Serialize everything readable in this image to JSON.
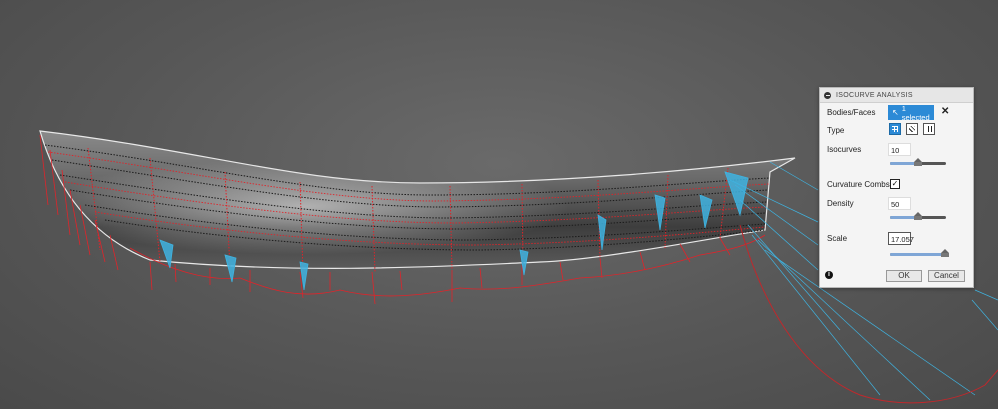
{
  "panel": {
    "title": "ISOCURVE ANALYSIS",
    "collapse_icon": "minus-circle-icon",
    "bodies_label": "Bodies/Faces",
    "selection_label": "1 selected",
    "selection_icon": "cursor-arrow-icon",
    "clear_icon": "close-icon",
    "type_label": "Type",
    "type_options": [
      "grid-both-icon",
      "diagonal-lines-icon",
      "vertical-lines-icon"
    ],
    "isocurves_label": "Isocurves",
    "isocurves_value": "10",
    "isocurves_slider_fraction": 0.5,
    "combs_label": "Curvature Combs",
    "combs_checked": true,
    "density_label": "Density",
    "density_value": "50",
    "density_slider_fraction": 0.5,
    "scale_label": "Scale",
    "scale_value": "17.057",
    "scale_slider_fraction": 0.98,
    "info_icon": "info-icon",
    "ok_label": "OK",
    "cancel_label": "Cancel",
    "accent_color": "#2c8ad6"
  },
  "viewport": {
    "background_color": "#575757",
    "comb_color_red": "#e0242a",
    "comb_color_blue": "#3fb3e0"
  }
}
